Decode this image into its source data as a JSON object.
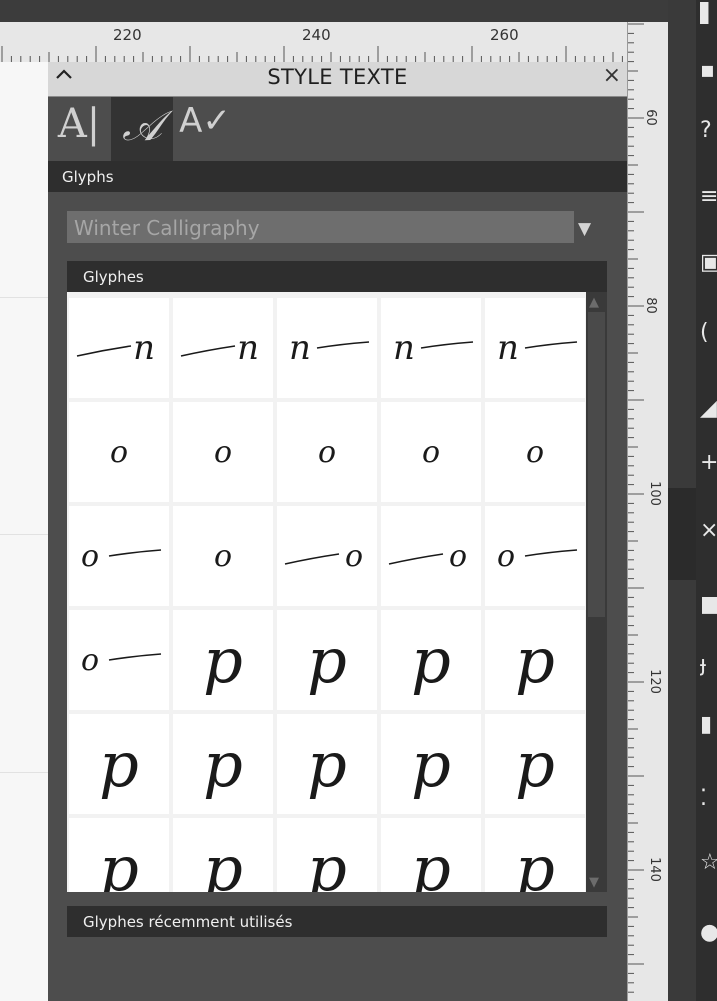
{
  "ruler": {
    "h_labels": [
      "220",
      "240",
      "260"
    ],
    "v_labels": [
      "60",
      "80",
      "100",
      "120",
      "140"
    ]
  },
  "panel": {
    "title": "STYLE TEXTE",
    "collapse_icon": "chevron-up-icon",
    "close_icon": "close-icon",
    "tabs": [
      {
        "name": "character-tab",
        "glyph": "A|"
      },
      {
        "name": "glyphs-tab",
        "glyph": "𝒜"
      },
      {
        "name": "spellcheck-tab",
        "glyph": "A✓"
      }
    ],
    "section_glyphs": "Glyphs",
    "font_name": "Winter Calligraphy",
    "glyph_box_title": "Glyphes",
    "recent_title": "Glyphes récemment utilisés"
  },
  "glyph_rows": [
    [
      "~n",
      "~n",
      "n~",
      "n~",
      "n~"
    ],
    [
      "o",
      "o",
      "o",
      "o",
      "o"
    ],
    [
      "o~",
      "o",
      "~o",
      "~o",
      "o~"
    ],
    [
      "o~",
      "p",
      "p",
      "p",
      "p"
    ],
    [
      "p",
      "p",
      "p",
      "p",
      "p"
    ],
    [
      "p",
      "p",
      "p",
      "p",
      "p"
    ]
  ],
  "colors": {
    "panel_bg": "#4d4d4d",
    "section_header": "#2e2e2e",
    "title_bar": "#d7d7d7"
  }
}
